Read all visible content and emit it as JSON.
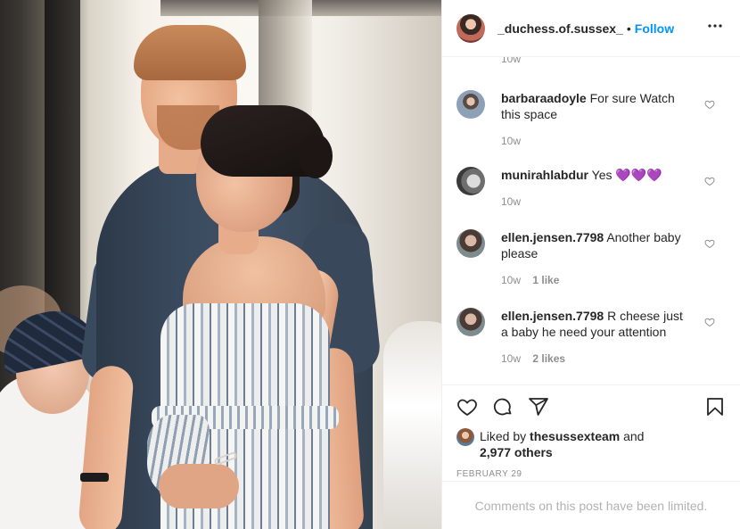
{
  "header": {
    "username": "_duchess.of.sussex_",
    "separator": "•",
    "follow_label": "Follow",
    "more_label": "•••"
  },
  "comments": {
    "cut_off_time": "10w",
    "items": [
      {
        "username": "barbaraadoyle",
        "text": "For sure Watch this space",
        "time": "10w",
        "likes": ""
      },
      {
        "username": "munirahlabdur",
        "text": "Yes 💜💜💜",
        "time": "10w",
        "likes": ""
      },
      {
        "username": "ellen.jensen.7798",
        "text": "Another baby please",
        "time": "10w",
        "likes": "1 like"
      },
      {
        "username": "ellen.jensen.7798",
        "text": "R cheese just a baby he need your attention",
        "time": "10w",
        "likes": "2 likes"
      }
    ]
  },
  "actions": {
    "icons": [
      "heart-icon",
      "comment-icon",
      "share-icon",
      "bookmark-icon"
    ],
    "liked_by_prefix": "Liked by",
    "liked_by_user": "thesussexteam",
    "liked_by_and": "and",
    "others_count": "2,977 others",
    "date": "FEBRUARY 29"
  },
  "footer": {
    "limited_text": "Comments on this post have been limited."
  },
  "colors": {
    "follow": "#0095f6",
    "text": "#262626",
    "muted": "#8e8e8e",
    "heart_emoji": "#a463e8"
  }
}
